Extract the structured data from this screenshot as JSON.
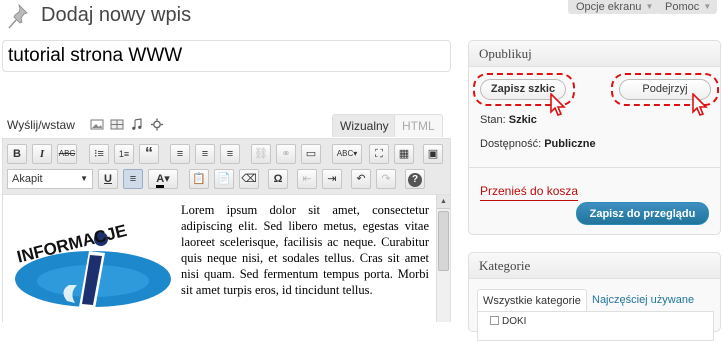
{
  "header": {
    "title": "Dodaj nowy wpis",
    "screen_options": "Opcje ekranu",
    "help": "Pomoc"
  },
  "post": {
    "title_value": "tutorial strona WWW"
  },
  "media": {
    "label": "Wyślij/wstaw",
    "icons": [
      "image-icon",
      "gallery-icon",
      "audio-icon",
      "media-icon"
    ]
  },
  "editor": {
    "tab_visual": "Wizualny",
    "tab_html": "HTML",
    "format_select": "Akapit",
    "logo_text": "INFORMACJE",
    "content": "Lorem ipsum dolor sit amet, consectetur adipiscing elit. Sed libero metus, egestas vitae laoreet scelerisque, facilisis ac neque. Curabitur quis neque nisi, et sodales tellus. Cras sit amet nisi quam. Sed fermentum tempus porta. Morbi sit amet turpis eros, id tincidunt tellus."
  },
  "toolbar": {
    "row1": [
      "B",
      "I",
      "ABC",
      "•≡",
      "1≡",
      "“",
      "≡",
      "≡",
      "≡",
      "🔗",
      "⛓",
      "▭",
      "ABC✓",
      "⛶",
      "▦",
      "▣"
    ],
    "row2": [
      "U",
      "≡",
      "A",
      "📋",
      "📋",
      "⌫",
      "Ω",
      "⇤",
      "⇥",
      "↶",
      "↷",
      "?"
    ]
  },
  "publish": {
    "heading": "Opublikuj",
    "save_draft": "Zapisz szkic",
    "preview": "Podejrzyj",
    "status_label": "Stan:",
    "status_value": "Szkic",
    "visibility_label": "Dostępność:",
    "visibility_value": "Publiczne",
    "trash": "Przenieś do kosza",
    "submit": "Zapisz do przeglądu"
  },
  "categories": {
    "heading": "Kategorie",
    "tab_all": "Wszystkie kategorie",
    "tab_popular": "Najczęściej używane",
    "first_item": "DOKI"
  },
  "colors": {
    "accent": "#21759b",
    "trash": "#bc0b0b",
    "highlight": "#dd1111"
  }
}
